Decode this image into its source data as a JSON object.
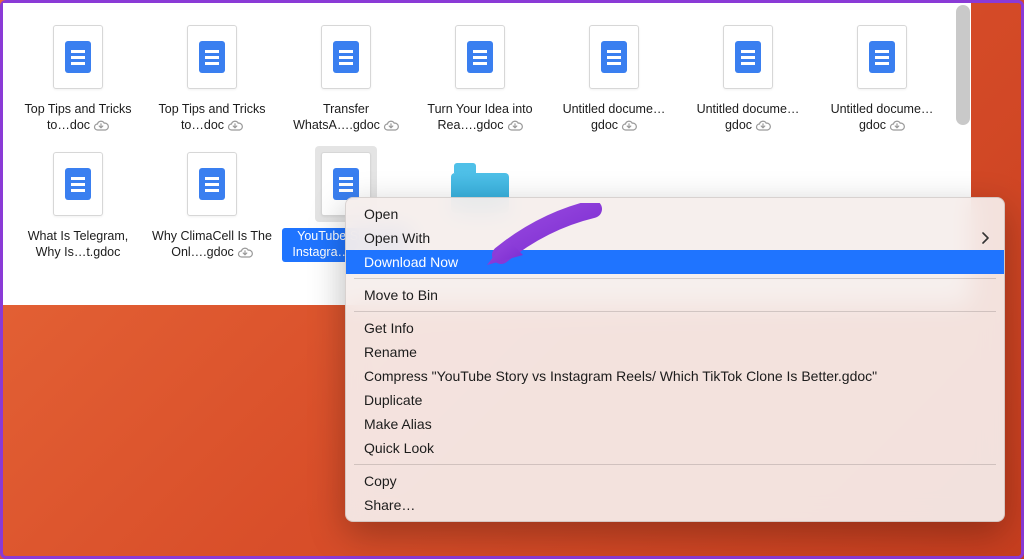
{
  "files_row1": [
    {
      "label": "Top Tips and Tricks to…doc",
      "cloud": true
    },
    {
      "label": "Top Tips and Tricks to…doc",
      "cloud": true
    },
    {
      "label": "Transfer WhatsA….gdoc",
      "cloud": true
    },
    {
      "label": "Turn Your Idea into Rea….gdoc",
      "cloud": true
    },
    {
      "label": "Untitled docume…gdoc",
      "cloud": true
    },
    {
      "label": "Untitled docume…gdoc",
      "cloud": true
    },
    {
      "label": "Untitled docume…gdoc",
      "cloud": true
    }
  ],
  "files_row2": [
    {
      "label": "What Is Telegram, Why Is…t.gdoc",
      "cloud": false
    },
    {
      "label": "Why ClimaCell Is The Onl….gdoc",
      "cloud": true
    },
    {
      "label": "YouTube Story vs Instagra….gdoc",
      "cloud": true,
      "selected": true
    },
    {
      "folder": true
    }
  ],
  "context_menu": {
    "open": "Open",
    "open_with": "Open With",
    "download_now": "Download Now",
    "move_to_bin": "Move to Bin",
    "get_info": "Get Info",
    "rename": "Rename",
    "compress": "Compress \"YouTube Story vs Instagram Reels/ Which TikTok Clone Is Better.gdoc\"",
    "duplicate": "Duplicate",
    "make_alias": "Make Alias",
    "quick_look": "Quick Look",
    "copy": "Copy",
    "share": "Share…"
  }
}
